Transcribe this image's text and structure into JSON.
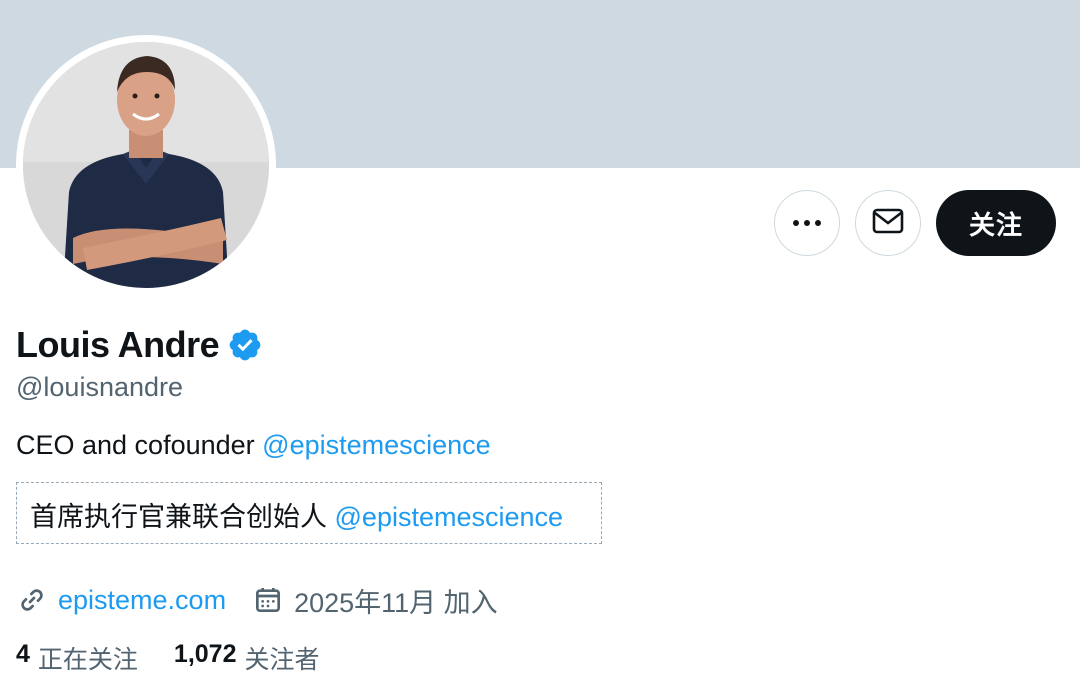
{
  "profile": {
    "display_name": "Louis Andre",
    "handle": "@louisnandre",
    "verified_color": "#1d9bf0",
    "bio_text": "CEO and cofounder ",
    "bio_mention": "@epistemescience",
    "translation_text": "首席执行官兼联合创始人 ",
    "translation_mention": "@epistemescience",
    "website": "episteme.com",
    "joined": "2025年11月 加入"
  },
  "actions": {
    "more_icon": "more-icon",
    "message_icon": "mail-icon",
    "follow_label": "关注"
  },
  "stats": {
    "following_count": "4",
    "following_label": "正在关注",
    "followers_count": "1,072",
    "followers_label": "关注者"
  },
  "colors": {
    "banner": "#cfd9e1",
    "accent": "#1d9bf0",
    "muted_text": "#536471",
    "primary_text": "#0f1419"
  }
}
